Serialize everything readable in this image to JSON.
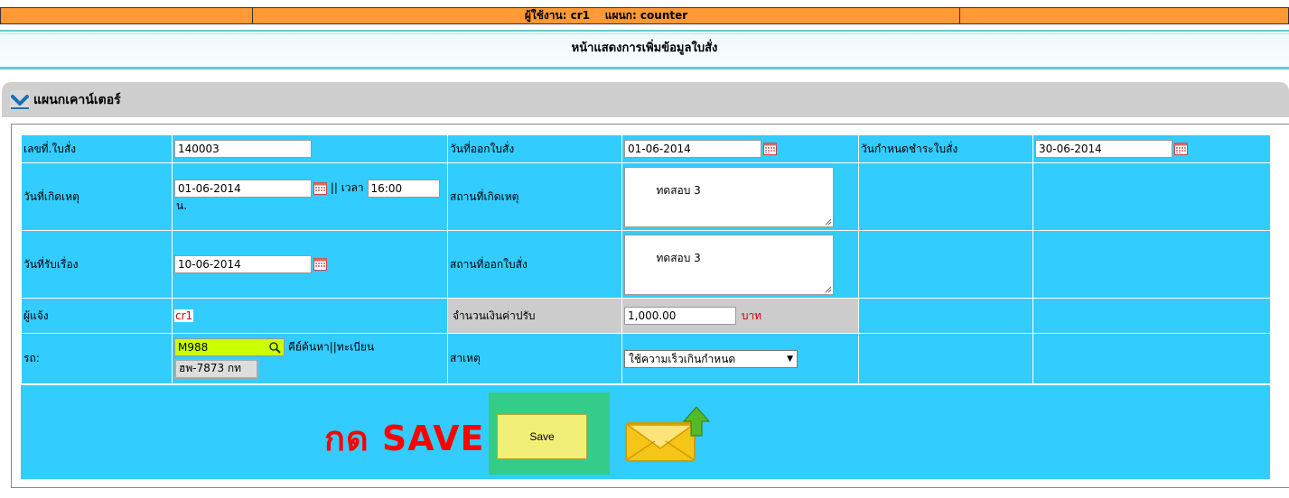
{
  "userbar": {
    "text": "ผู้ใช้งาน: cr1    แผนก: counter"
  },
  "page_title": "หน้าแสดงการเพิ่มข้อมูลใบสั่ง",
  "section": {
    "title": "แผนกเคาน์เตอร์"
  },
  "form": {
    "ticket_no": {
      "label": "เลขที่.ใบสั่ง",
      "value": "140003"
    },
    "issue_date": {
      "label": "วันที่ออกใบสั่ง",
      "value": "01-06-2014"
    },
    "due_date": {
      "label": "วันกำหนดชำระใบสั่ง",
      "value": "30-06-2014"
    },
    "incident_date": {
      "label": "วันที่เกิดเหตุ",
      "value": "01-06-2014",
      "time_label": "|| เวลา",
      "time_value": "16:00",
      "time_unit": "น."
    },
    "incident_place": {
      "label": "สถานที่เกิดเหตุ",
      "value": "ทดสอบ 3"
    },
    "received_date": {
      "label": "วันที่รับเรื่อง",
      "value": "10-06-2014"
    },
    "issue_place": {
      "label": "สถานที่ออกใบสั่ง",
      "value": "ทดสอบ 3"
    },
    "reporter": {
      "label": "ผู้แจ้ง",
      "value": "cr1"
    },
    "fine": {
      "label": "จำนวนเงินค่าปรับ",
      "value": "1,000.00",
      "unit": "บาท"
    },
    "car": {
      "label": "รถ:",
      "search_value": "M988",
      "search_hint": "คีย์ค้นหา||ทะเบียน",
      "plate": "ฮพ-7873 กท"
    },
    "cause": {
      "label": "สาเหตุ",
      "selected": "ใช้ความเร็วเกินกำหนด"
    }
  },
  "actions": {
    "press_label": "กด SAVE",
    "save_label": "Save"
  },
  "colors": {
    "accent_orange": "#ff9933",
    "grid_blue": "#33ccff",
    "save_green": "#33cc88",
    "search_yellow": "#ccff00"
  }
}
